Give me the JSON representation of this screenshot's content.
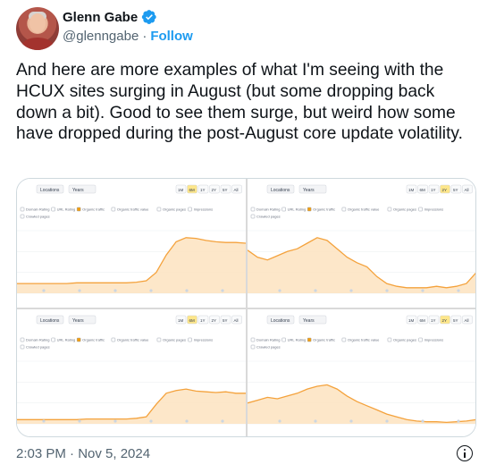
{
  "author": {
    "name": "Glenn Gabe",
    "handle": "@glenngabe",
    "separator": "·",
    "follow_label": "Follow"
  },
  "tweet": {
    "text": "And here are more examples of what I'm seeing with the HCUX sites surging in August (but some dropping back down a bit). Good to see them surge, but weird how some have dropped during the post-August core update volatility.",
    "timestamp": "2:03 PM · Nov 5, 2024"
  },
  "colors": {
    "accent": "#1d9bf0",
    "traffic_line": "#f4a23c",
    "traffic_fill": "#fde3bf"
  },
  "chart_ui": {
    "toolbar": [
      "Locations",
      "Years"
    ],
    "ranges": [
      "1M",
      "6M",
      "1Y",
      "2Y",
      "5Y",
      "All"
    ],
    "metrics": [
      "Domain Rating",
      "URL Rating",
      "Organic traffic",
      "Organic traffic value",
      "Organic pages",
      "Impressions"
    ],
    "sub_metric": "Crawled pages"
  },
  "chart_data": [
    {
      "type": "area",
      "series": [
        {
          "name": "Organic traffic",
          "values": [
            14,
            14,
            14,
            14,
            14,
            14,
            15,
            15,
            15,
            15,
            15,
            15,
            16,
            18,
            30,
            55,
            74,
            80,
            79,
            76,
            74,
            73,
            73,
            72
          ]
        }
      ]
    },
    {
      "type": "area",
      "series": [
        {
          "name": "Organic traffic",
          "values": [
            62,
            52,
            48,
            54,
            60,
            64,
            72,
            80,
            76,
            64,
            52,
            44,
            38,
            24,
            14,
            10,
            8,
            8,
            8,
            10,
            8,
            10,
            14,
            30
          ]
        }
      ]
    },
    {
      "type": "area",
      "series": [
        {
          "name": "Organic traffic",
          "values": [
            6,
            6,
            6,
            6,
            6,
            6,
            6,
            7,
            7,
            7,
            7,
            7,
            8,
            10,
            28,
            44,
            48,
            50,
            47,
            46,
            45,
            46,
            44,
            44
          ]
        }
      ]
    },
    {
      "type": "area",
      "series": [
        {
          "name": "Organic traffic",
          "values": [
            30,
            34,
            38,
            36,
            40,
            44,
            50,
            54,
            56,
            50,
            40,
            32,
            26,
            20,
            14,
            10,
            6,
            4,
            3,
            3,
            2,
            3,
            4,
            6
          ]
        }
      ]
    }
  ]
}
